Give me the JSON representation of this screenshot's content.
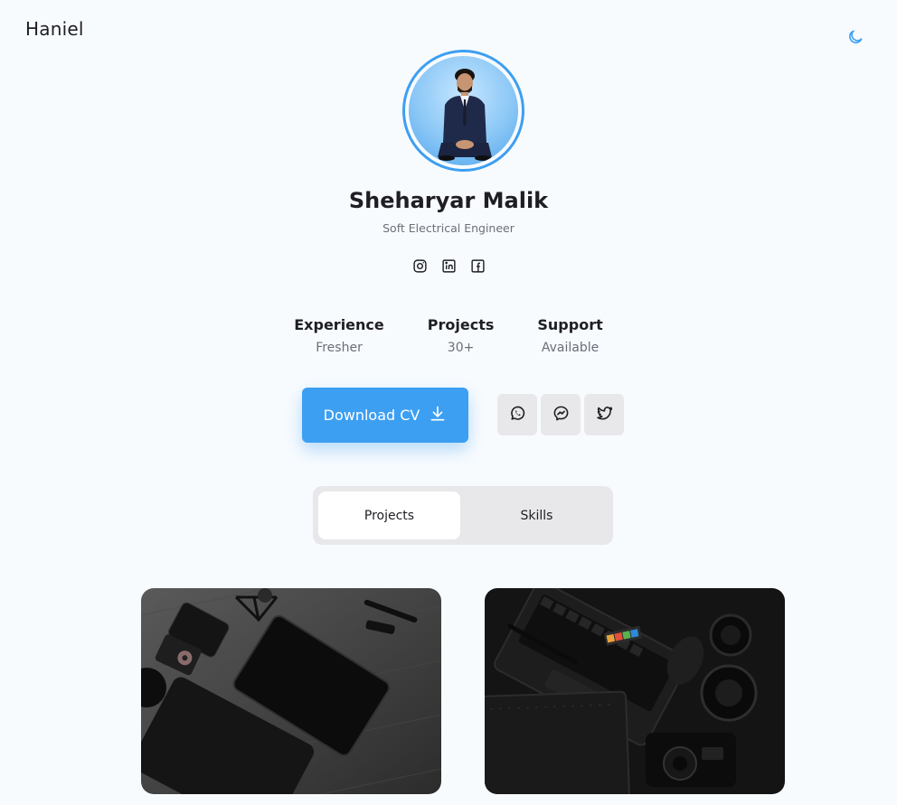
{
  "header": {
    "brand": "Haniel",
    "theme_toggle_icon": "moon-icon"
  },
  "profile": {
    "name": "Sheharyar Malik",
    "role": "Soft Electrical Engineer",
    "socials": [
      {
        "icon": "instagram-icon"
      },
      {
        "icon": "linkedin-icon"
      },
      {
        "icon": "facebook-icon"
      }
    ]
  },
  "stats": [
    {
      "title": "Experience",
      "value": "Fresher"
    },
    {
      "title": "Projects",
      "value": "30+"
    },
    {
      "title": "Support",
      "value": "Available"
    }
  ],
  "actions": {
    "download_label": "Download CV",
    "download_icon": "download-icon",
    "contact_icons": [
      "whatsapp-icon",
      "messenger-icon",
      "twitter-icon"
    ]
  },
  "tabs": [
    {
      "label": "Projects",
      "active": true
    },
    {
      "label": "Skills",
      "active": false
    }
  ],
  "colors": {
    "accent": "#3d9ff1",
    "background": "#f8fbfe",
    "muted_surface": "#e8e8ea"
  }
}
